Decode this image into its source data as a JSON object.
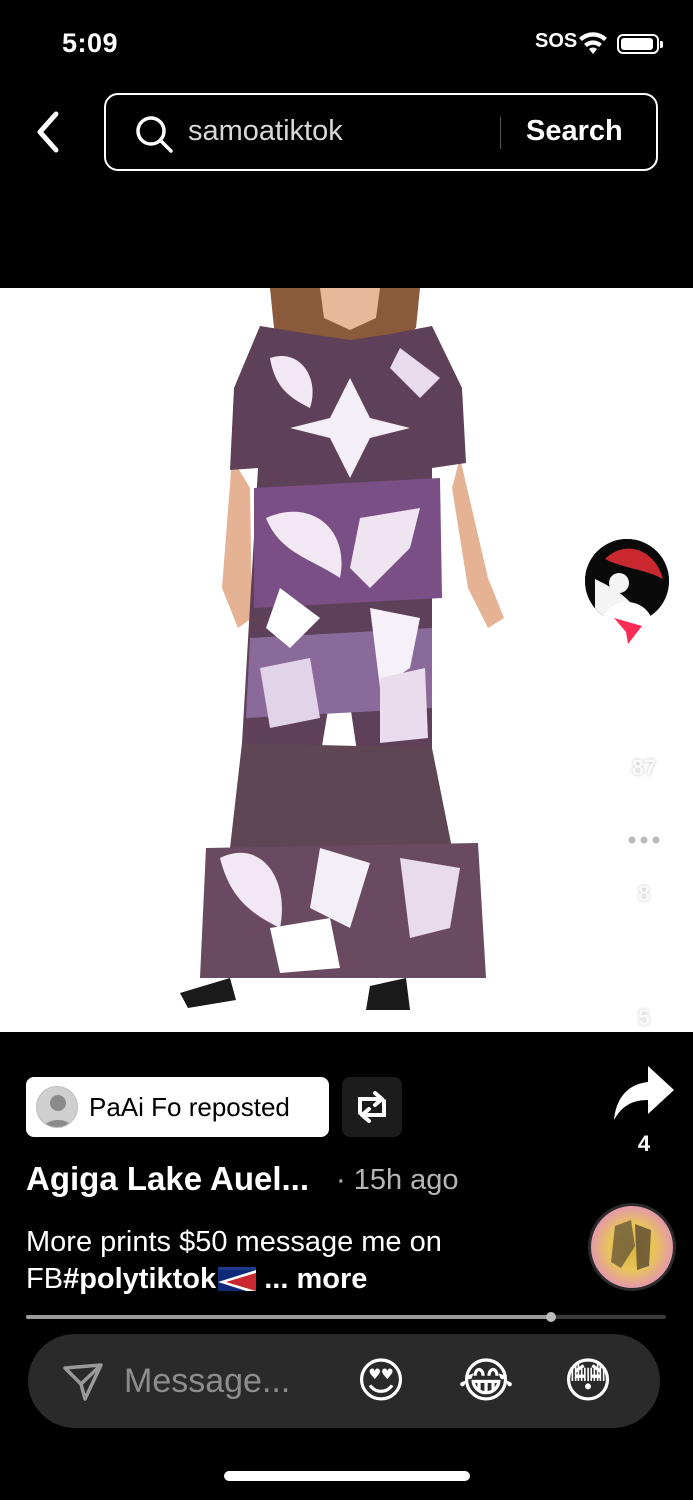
{
  "status": {
    "time": "5:09",
    "sos": "SOS"
  },
  "search": {
    "query": "samoatiktok",
    "button_label": "Search"
  },
  "actions": {
    "likes": "87",
    "comments": "8",
    "saves": "5",
    "shares": "4"
  },
  "post": {
    "repost_label": "PaAi Fo reposted",
    "author": "Agiga Lake Auel...",
    "time_ago": "· 15h ago",
    "caption_text": "More prints $50 message me on FB",
    "caption_hashtag": "#polytiktok",
    "caption_more": "... more"
  },
  "playback": {
    "progress": 0.82
  },
  "composer": {
    "placeholder": "Message...",
    "emojis": [
      "😍",
      "😂",
      "😳"
    ]
  },
  "colors": {
    "dress_purple": "#5e4058",
    "print_light": "#d8c4e0",
    "accent_red": "#fe2c55"
  },
  "icons": [
    "back-icon",
    "search-icon",
    "follow-plus-icon",
    "heart-icon",
    "comment-icon",
    "bookmark-icon",
    "share-icon",
    "repost-icon",
    "send-icon"
  ]
}
